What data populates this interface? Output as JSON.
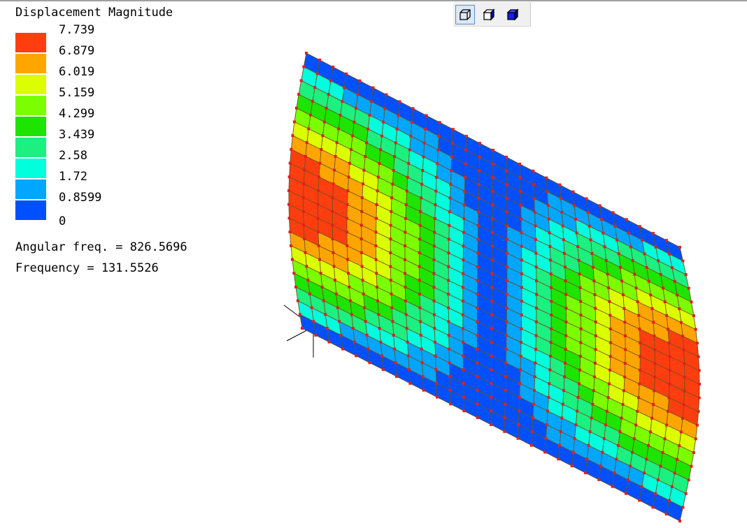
{
  "legend": {
    "title": "Displacement Magnitude",
    "ticks": [
      "7.739",
      "6.879",
      "6.019",
      "5.159",
      "4.299",
      "3.439",
      "2.58",
      "1.72",
      "0.8599",
      "0"
    ],
    "colors": [
      "#ff3e10",
      "#ffa500",
      "#dcff00",
      "#7bff00",
      "#1de400",
      "#1cf080",
      "#00ffdc",
      "#00a6ff",
      "#0050ff"
    ],
    "min": 0,
    "max": 7.739
  },
  "info": {
    "angular_freq": "Angular freq. = 826.5696",
    "frequency": "Frequency = 131.5526"
  },
  "toolbar": {
    "buttons": [
      {
        "icon": "wireframe-cube-icon",
        "active": true
      },
      {
        "icon": "hidden-line-cube-icon",
        "active": false
      },
      {
        "icon": "solid-cube-icon",
        "active": false
      }
    ]
  },
  "mesh": {
    "rows": 20,
    "cols": 28,
    "node_color": "#e02020",
    "edge_color": "#6e5020"
  }
}
